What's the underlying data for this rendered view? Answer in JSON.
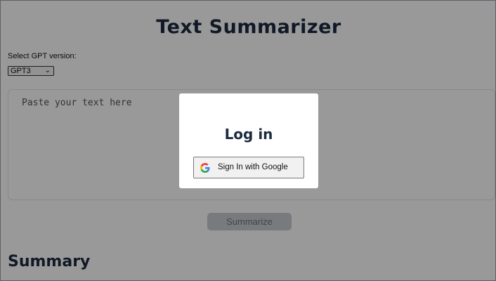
{
  "app": {
    "title": "Text Summarizer"
  },
  "version": {
    "label": "Select GPT version:",
    "selected": "GPT3"
  },
  "input": {
    "placeholder": "Paste your text here"
  },
  "actions": {
    "summarize_label": "Summarize"
  },
  "summary": {
    "heading": "Summary"
  },
  "login_modal": {
    "title": "Log in",
    "google_button_label": "Sign In with Google",
    "google_icon": "google-g-icon"
  },
  "colors": {
    "heading": "#1c2b3f",
    "overlay": "rgba(0,0,0,0.4)",
    "google_blue": "#4285F4",
    "google_red": "#EA4335",
    "google_yellow": "#FBBC05",
    "google_green": "#34A853"
  }
}
